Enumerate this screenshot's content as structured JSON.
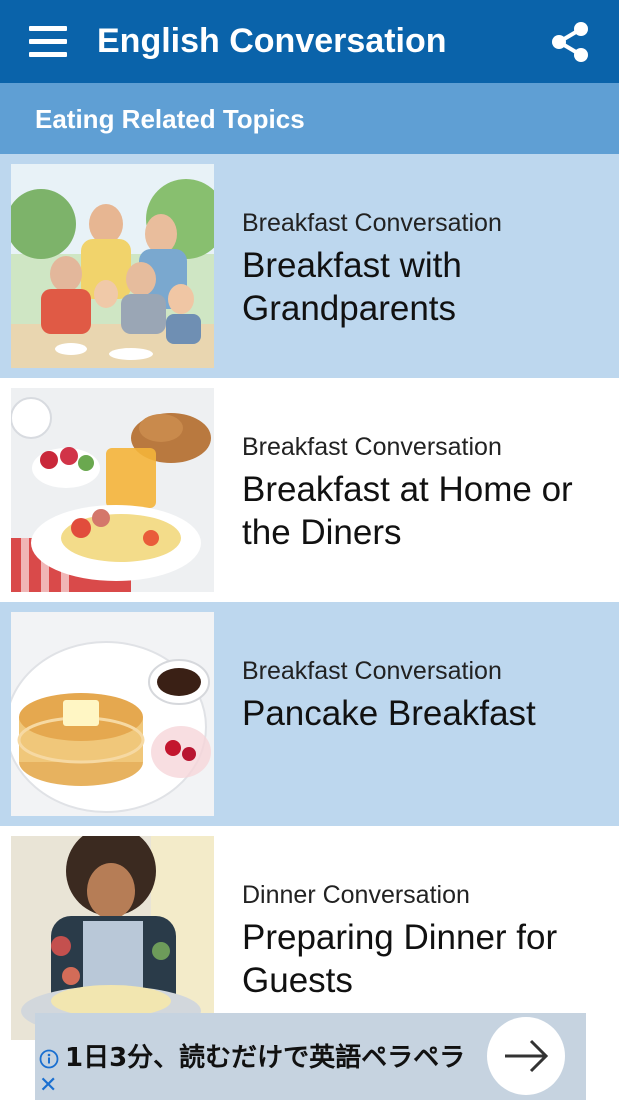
{
  "app_bar": {
    "title": "English Conversation",
    "menu_icon": "hamburger-menu-icon",
    "share_icon": "share-icon",
    "background": "#0a63aa"
  },
  "section": {
    "title": "Eating Related Topics",
    "background": "#5f9fd4"
  },
  "items": [
    {
      "category": "Breakfast Conversation",
      "title": "Breakfast with Grandparents",
      "image": "family-breakfast-photo"
    },
    {
      "category": "Breakfast Conversation",
      "title": "Breakfast at Home or the Diners",
      "image": "breakfast-spread-photo"
    },
    {
      "category": "Breakfast Conversation",
      "title": "Pancake Breakfast",
      "image": "pancakes-photo"
    },
    {
      "category": "Dinner Conversation",
      "title": "Preparing Dinner for Guests",
      "image": "woman-cooking-photo"
    }
  ],
  "ad": {
    "text": "1日3分、読むだけで英語ペラペラ",
    "info_icon": "info-icon",
    "close_icon": "close-icon",
    "arrow_icon": "arrow-right-icon"
  }
}
